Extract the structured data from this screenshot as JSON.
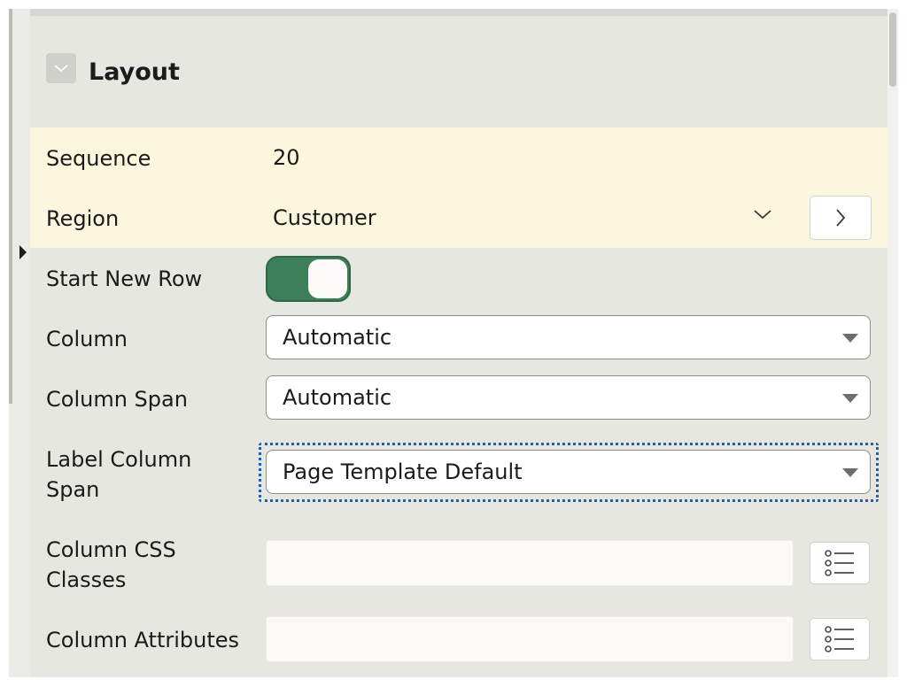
{
  "section": {
    "title": "Layout"
  },
  "fields": {
    "sequence": {
      "label": "Sequence",
      "value": "20"
    },
    "region": {
      "label": "Region",
      "value": "Customer"
    },
    "start_new_row": {
      "label": "Start New Row",
      "enabled": true
    },
    "column": {
      "label": "Column",
      "value": "Automatic"
    },
    "column_span": {
      "label": "Column Span",
      "value": "Automatic"
    },
    "label_column_span": {
      "label_line1": "Label Column",
      "label_line2": "Span",
      "value": "Page Template Default"
    },
    "column_css_classes": {
      "label_line1": "Column CSS",
      "label_line2": "Classes",
      "value": ""
    },
    "column_attributes": {
      "label": "Column Attributes",
      "value": ""
    }
  },
  "colors": {
    "highlight_bg": "#fbf6de",
    "panel_bg": "#e5e7e0",
    "toggle_on": "#3d7f59",
    "focus": "#1d5fb8"
  },
  "icons": {
    "collapse": "chevron-down-icon",
    "region_dropdown": "chevron-down-icon",
    "region_nav": "chevron-right-icon",
    "list_picker": "list-icon",
    "splitter": "caret-right-icon"
  }
}
